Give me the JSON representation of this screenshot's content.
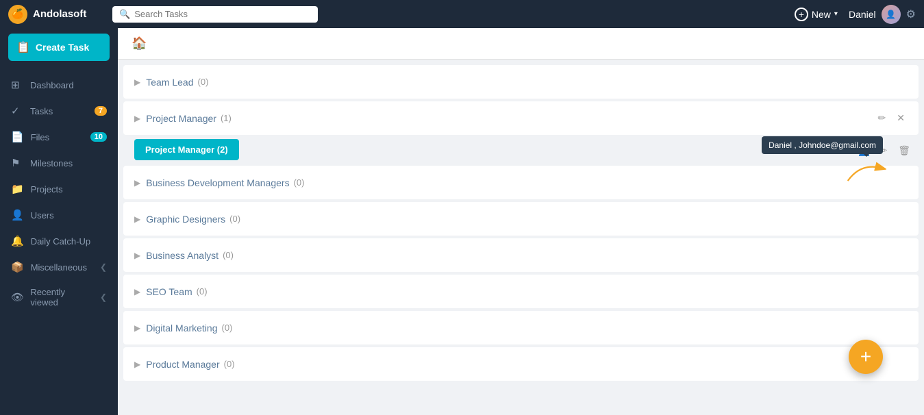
{
  "app": {
    "name": "Andolasoft",
    "logo_emoji": "🍊"
  },
  "topnav": {
    "search_placeholder": "Search Tasks",
    "new_label": "New",
    "user_name": "Daniel",
    "gear_symbol": "⚙"
  },
  "sidebar": {
    "create_task_label": "Create Task",
    "items": [
      {
        "id": "dashboard",
        "label": "Dashboard",
        "icon": "⊞",
        "badge": null
      },
      {
        "id": "tasks",
        "label": "Tasks",
        "icon": "✓",
        "badge": "7"
      },
      {
        "id": "files",
        "label": "Files",
        "icon": "📄",
        "badge": "10"
      },
      {
        "id": "milestones",
        "label": "Milestones",
        "icon": "⚑",
        "badge": null
      },
      {
        "id": "projects",
        "label": "Projects",
        "icon": "📁",
        "badge": null
      },
      {
        "id": "users",
        "label": "Users",
        "icon": "👤",
        "badge": null
      },
      {
        "id": "daily-catch-up",
        "label": "Daily Catch-Up",
        "icon": "🔔",
        "badge": null
      },
      {
        "id": "miscellaneous",
        "label": "Miscellaneous",
        "icon": "📦",
        "badge": null,
        "has_chevron": true
      },
      {
        "id": "recently-viewed",
        "label": "Recently viewed",
        "icon": "👁",
        "badge": null,
        "has_chevron": true
      }
    ]
  },
  "content": {
    "home_icon": "🏠",
    "groups": [
      {
        "id": "team-lead",
        "name": "Team Lead",
        "count": "(0)",
        "active": false,
        "show_actions": false
      },
      {
        "id": "project-manager-1",
        "name": "Project Manager",
        "count": "(1)",
        "active": false,
        "show_actions": true
      },
      {
        "id": "project-manager-active",
        "name": "Project Manager",
        "count": "(2)",
        "active": true,
        "is_button": true
      },
      {
        "id": "business-dev",
        "name": "Business Development Managers",
        "count": "(0)",
        "active": false,
        "show_actions": false
      },
      {
        "id": "graphic-designers",
        "name": "Graphic Designers",
        "count": "(0)",
        "active": false,
        "show_actions": false
      },
      {
        "id": "business-analyst",
        "name": "Business Analyst",
        "count": "(0)",
        "active": false,
        "show_actions": false
      },
      {
        "id": "seo-team",
        "name": "SEO Team",
        "count": "(0)",
        "active": false,
        "show_actions": false
      },
      {
        "id": "digital-marketing",
        "name": "Digital Marketing",
        "count": "(0)",
        "active": false,
        "show_actions": false
      },
      {
        "id": "product-manager",
        "name": "Product Manager",
        "count": "(0)",
        "active": false,
        "show_actions": false
      }
    ],
    "tooltip_text": "Daniel , Johndoe@gmail.com",
    "fab_label": "+"
  }
}
